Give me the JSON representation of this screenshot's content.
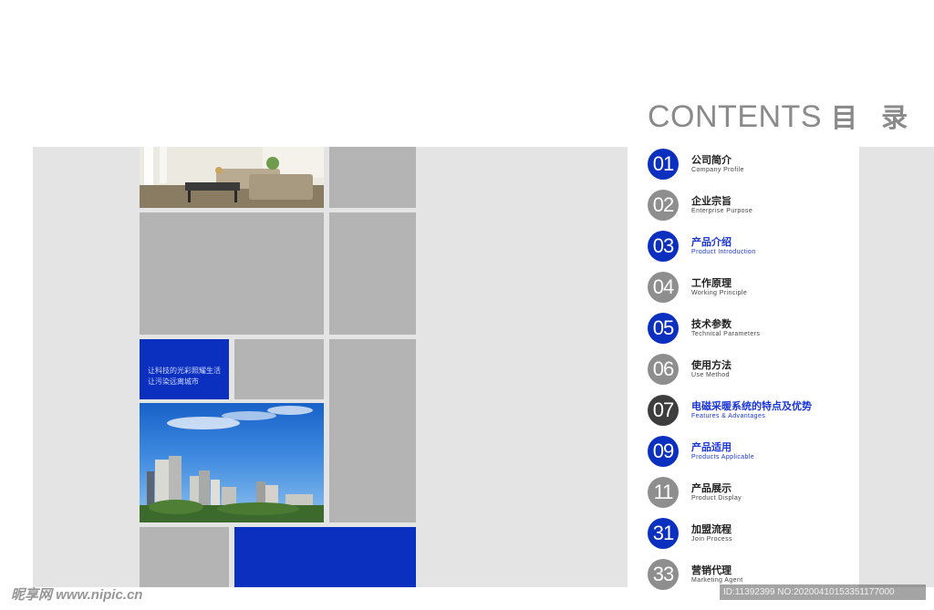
{
  "header": {
    "title_en": "CONTENTS",
    "title_zh": "目 录"
  },
  "left_page": {
    "slogan_line1": "让科技的光彩照耀生活",
    "slogan_line2": "让污染远离城市"
  },
  "colors": {
    "accent_blue": "#0b2fbf",
    "highlight_blue": "#1a35d8",
    "dark_circle": "#3d3d3d",
    "gray_circle": "#8e8e8e",
    "tile_gray": "#b4b4b4"
  },
  "toc": [
    {
      "num": "01",
      "zh": "公司简介",
      "en": "Company Profile",
      "style": "blue"
    },
    {
      "num": "02",
      "zh": "企业宗旨",
      "en": "Enterprise Purpose",
      "style": "gray"
    },
    {
      "num": "03",
      "zh": "产品介绍",
      "en": "Product Introduction",
      "style": "blue-hl"
    },
    {
      "num": "04",
      "zh": "工作原理",
      "en": "Working Principle",
      "style": "gray"
    },
    {
      "num": "05",
      "zh": "技术参数",
      "en": "Technical Parameters",
      "style": "blue"
    },
    {
      "num": "06",
      "zh": "使用方法",
      "en": "Use Method",
      "style": "gray"
    },
    {
      "num": "07",
      "zh": "电磁采暖系统的特点及优势",
      "en": "Features & Advantages",
      "style": "dark-hl"
    },
    {
      "num": "09",
      "zh": "产品适用",
      "en": "Products Applicable",
      "style": "blue-hl"
    },
    {
      "num": "11",
      "zh": "产品展示",
      "en": "Product Display",
      "style": "gray"
    },
    {
      "num": "31",
      "zh": "加盟流程",
      "en": "Join Process",
      "style": "blue"
    },
    {
      "num": "33",
      "zh": "营销代理",
      "en": "Marketing Agent",
      "style": "gray"
    }
  ],
  "watermark": {
    "left": "昵享网 www.nipic.cn",
    "right": "ID:11392399 NO:20200410153351177000"
  }
}
